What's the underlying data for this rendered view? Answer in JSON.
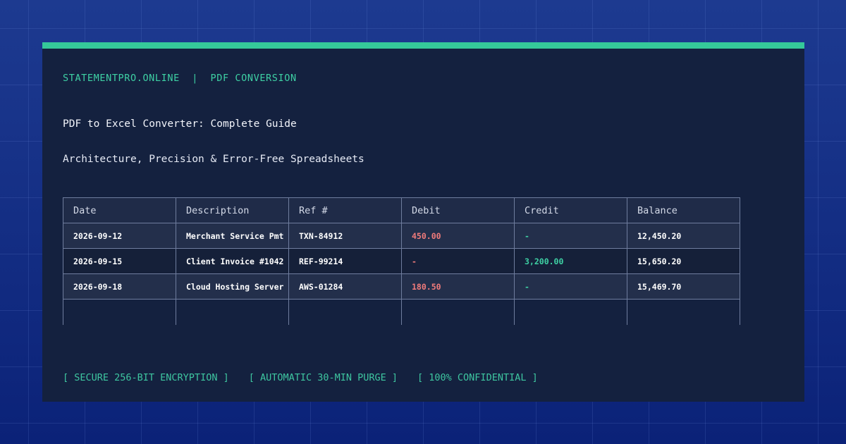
{
  "header": {
    "brand": "STATEMENTPRO.ONLINE",
    "separator": "|",
    "category": "PDF CONVERSION"
  },
  "title": "PDF to Excel Converter: Complete Guide",
  "subtitle": "Architecture, Precision & Error-Free Spreadsheets",
  "table": {
    "columns": [
      "Date",
      "Description",
      "Ref #",
      "Debit",
      "Credit",
      "Balance"
    ],
    "rows": [
      [
        "2026-09-12",
        "Merchant Service Pmt",
        "TXN-84912",
        "450.00",
        "-",
        "12,450.20"
      ],
      [
        "2026-09-15",
        "Client Invoice #1042",
        "REF-99214",
        "-",
        "3,200.00",
        "15,650.20"
      ],
      [
        "2026-09-18",
        "Cloud Hosting Server",
        "AWS-01284",
        "180.50",
        "-",
        "15,469.70"
      ]
    ]
  },
  "footer": {
    "tags": [
      "[ SECURE 256-BIT ENCRYPTION ]",
      "[ AUTOMATIC 30-MIN PURGE ]",
      "[ 100% CONFIDENTIAL ]"
    ]
  },
  "colors": {
    "background": "#0f2a7e",
    "card": "#14213f",
    "accent": "#35c99a",
    "debit": "#f07b7b",
    "credit": "#3ed1a4"
  }
}
